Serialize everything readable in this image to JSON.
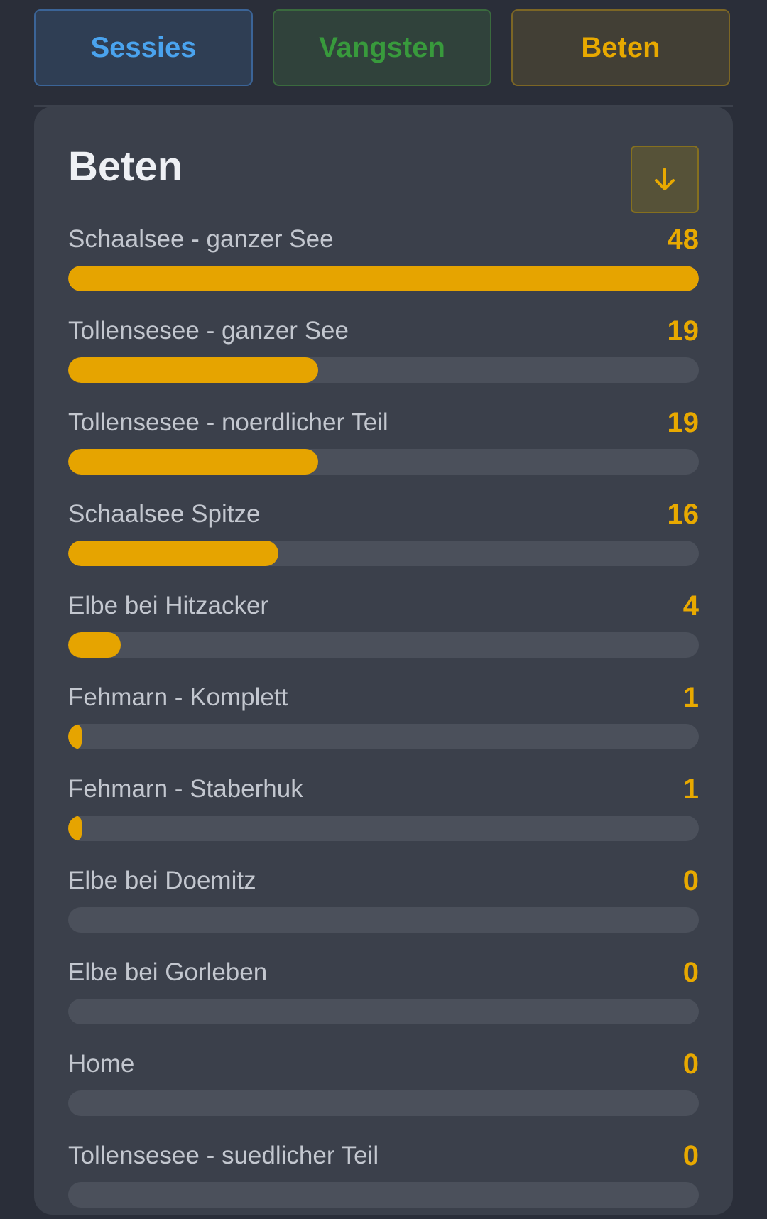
{
  "tabs": {
    "sessies": "Sessies",
    "vangsten": "Vangsten",
    "beten": "Beten"
  },
  "card": {
    "title": "Beten",
    "sort_icon": "arrow-down-icon"
  },
  "colors": {
    "accent": "#e6a400",
    "sessies": "#4aa3ee",
    "vangsten": "#389a3c"
  },
  "rows": [
    {
      "label": "Schaalsee - ganzer See",
      "count": "48",
      "value": 48
    },
    {
      "label": "Tollensesee - ganzer See",
      "count": "19",
      "value": 19
    },
    {
      "label": "Tollensesee - noerdlicher Teil",
      "count": "19",
      "value": 19
    },
    {
      "label": "Schaalsee Spitze",
      "count": "16",
      "value": 16
    },
    {
      "label": "Elbe bei Hitzacker",
      "count": "4",
      "value": 4
    },
    {
      "label": "Fehmarn - Komplett",
      "count": "1",
      "value": 1
    },
    {
      "label": "Fehmarn - Staberhuk",
      "count": "1",
      "value": 1
    },
    {
      "label": "Elbe bei Doemitz",
      "count": "0",
      "value": 0
    },
    {
      "label": "Elbe bei Gorleben",
      "count": "0",
      "value": 0
    },
    {
      "label": "Home",
      "count": "0",
      "value": 0
    },
    {
      "label": "Tollensesee - suedlicher Teil",
      "count": "0",
      "value": 0
    }
  ],
  "max_value": 48
}
